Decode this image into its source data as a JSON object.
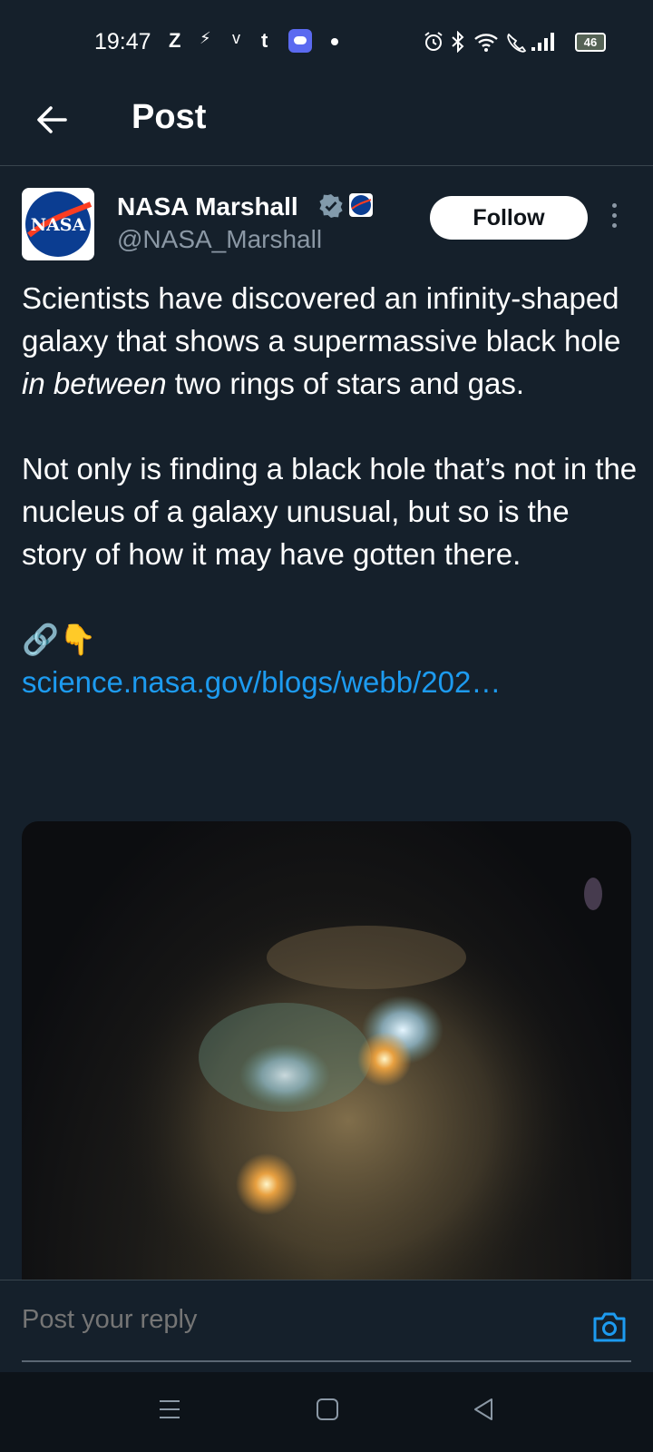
{
  "status_bar": {
    "time": "19:47",
    "app_icons": [
      "Z",
      "⚡",
      "v",
      "t"
    ],
    "battery": "46"
  },
  "header": {
    "title": "Post",
    "back_icon": "arrow-left-icon"
  },
  "post": {
    "author": {
      "name": "NASA Marshall",
      "handle": "@NASA_Marshall",
      "avatar_text": "NASA"
    },
    "follow_label": "Follow",
    "paragraphs": [
      {
        "before": "Scientists have discovered an infinity-shaped galaxy that shows a supermassive black hole ",
        "emphasis": "in between",
        "after": " two rings of stars and gas."
      },
      {
        "text": "Not only is finding a black hole that’s not in the nucleus of a galaxy unusual, but so is the story of how it may have gotten there."
      }
    ],
    "emoji": "🔗👇",
    "link": "science.nasa.gov/blogs/webb/202…"
  },
  "reply": {
    "placeholder": "Post your reply"
  },
  "colors": {
    "background": "#15202b",
    "link": "#1d9bf0",
    "secondary_text": "#8b98a5",
    "verified": "#829aab"
  }
}
